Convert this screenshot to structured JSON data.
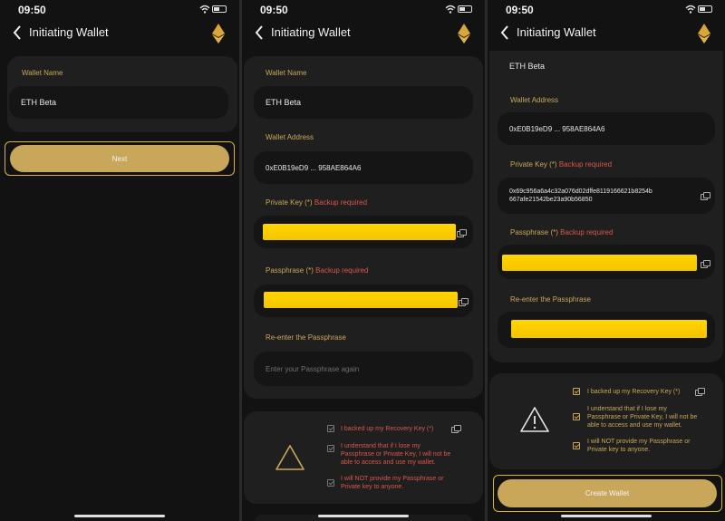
{
  "status": {
    "time": "09:50"
  },
  "nav": {
    "title": "Initiating Wallet"
  },
  "labels": {
    "wallet_name": "Wallet Name",
    "wallet_address": "Wallet Address",
    "private_key": "Private Key (*)",
    "passphrase": "Passphrase (*)",
    "backup_required": "Backup required",
    "reenter": "Re-enter the Passphrase"
  },
  "values": {
    "wallet_name": "ETH Beta",
    "wallet_address": "0xE0B19eD9 ... 958AE864A6",
    "private_key_line1": "0x69c956a6a4c32a076d02dffe8119166621b8254b",
    "private_key_line2": "667afe21542be23a90b56850",
    "reenter_placeholder": "Enter your Passphrase again"
  },
  "buttons": {
    "next": "Next",
    "create": "Create Wallet"
  },
  "confirm": {
    "backed_up": "I backed up my Recovery Key (*)",
    "lose_line1": "I understand that if I lose my",
    "lose_line2": "Passphrase or Private Key, I will not be",
    "lose_line3": "able to access and use my wallet.",
    "not_provide_line1": "I will NOT provide my Passphrase or",
    "not_provide_line2": "Private key to anyone."
  },
  "colors": {
    "accent": "#c9a75a",
    "required": "#d8574a",
    "background": "#121212",
    "card": "#1f1f1f",
    "redaction": "#ffd500"
  }
}
